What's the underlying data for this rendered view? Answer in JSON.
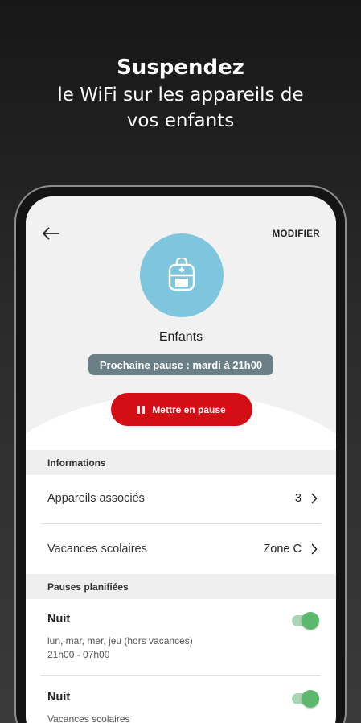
{
  "headline": {
    "title": "Suspendez",
    "line1": "le WiFi sur les appareils de",
    "line2": "vos enfants"
  },
  "header": {
    "back_icon": "arrow-left-icon",
    "modify_label": "MODIFIER"
  },
  "profile": {
    "avatar_icon": "backpack-icon",
    "avatar_color": "#7ec6dd",
    "name": "Enfants",
    "next_pause": "Prochaine pause : mardi à 21h00"
  },
  "pause_button": {
    "label": "Mettre en pause",
    "icon": "pause-icon",
    "color": "#d40e15"
  },
  "informations": {
    "heading": "Informations",
    "rows": [
      {
        "label": "Appareils associés",
        "value": "3"
      },
      {
        "label": "Vacances scolaires",
        "value": "Zone C"
      }
    ]
  },
  "planned_pauses": {
    "heading": "Pauses planifiées",
    "items": [
      {
        "title": "Nuit",
        "days": "lun, mar, mer, jeu (hors vacances)",
        "hours": "21h00 - 07h00",
        "enabled": true
      },
      {
        "title": "Nuit",
        "days": "Vacances scolaires",
        "enabled": true
      }
    ]
  }
}
